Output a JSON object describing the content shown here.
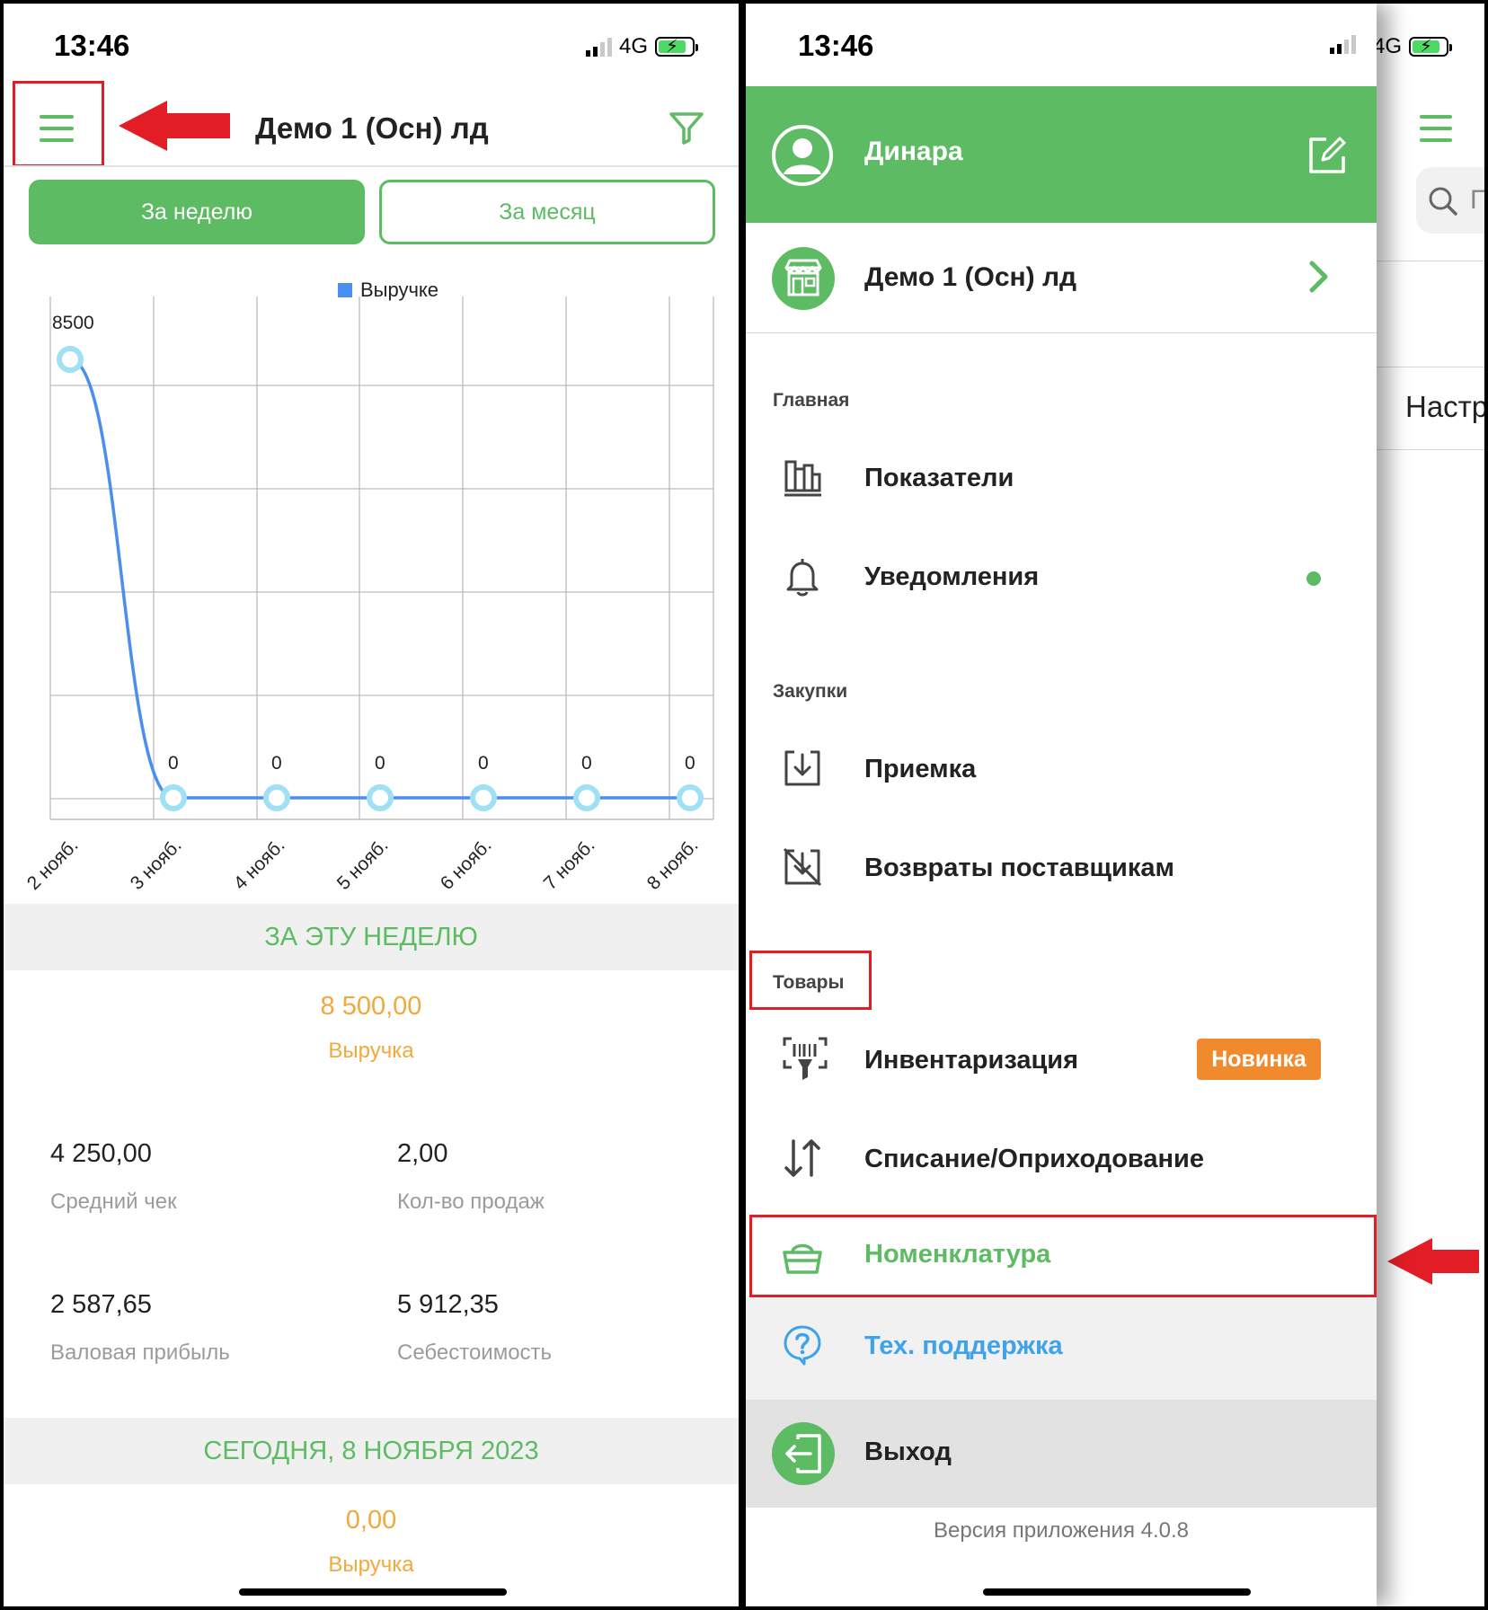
{
  "left": {
    "status": {
      "time": "13:46",
      "network": "4G"
    },
    "header": {
      "title": "Демо 1 (Осн) лд",
      "menu_icon": "hamburger-icon",
      "filter_icon": "funnel-icon"
    },
    "tabs": {
      "week": "За неделю",
      "month": "За месяц"
    },
    "chart_data": {
      "type": "line",
      "legend": "Выручке",
      "categories": [
        "2 нояб.",
        "3 нояб.",
        "4 нояб.",
        "5 нояб.",
        "6 нояб.",
        "7 нояб.",
        "8 нояб."
      ],
      "values": [
        8500,
        0,
        0,
        0,
        0,
        0,
        0
      ],
      "data_labels": [
        "8500",
        "0",
        "0",
        "0",
        "0",
        "0",
        "0"
      ],
      "grid": true,
      "line_color": "#4a8ff0",
      "marker_color": "#9fe0f5"
    },
    "week_summary": {
      "heading": "ЗА ЭТУ НЕДЕЛЮ",
      "revenue_value": "8 500,00",
      "revenue_label": "Выручка",
      "metrics": [
        {
          "value": "4 250,00",
          "label": "Средний чек"
        },
        {
          "value": "2,00",
          "label": "Кол-во продаж"
        },
        {
          "value": "2 587,65",
          "label": "Валовая прибыль"
        },
        {
          "value": "5 912,35",
          "label": "Себестоимость"
        }
      ]
    },
    "today": {
      "heading": "СЕГОДНЯ,  8 НОЯБРЯ 2023",
      "revenue_value": "0,00",
      "revenue_label": "Выручка"
    }
  },
  "right": {
    "status": {
      "time": "13:46",
      "network": "4G"
    },
    "profile": {
      "name": "Динара"
    },
    "store": {
      "name": "Демо 1 (Осн) лд"
    },
    "sections": {
      "main": "Главная",
      "purchases": "Закупки",
      "goods": "Товары"
    },
    "menu": {
      "indicators": "Показатели",
      "notifications": "Уведомления",
      "receiving": "Приемка",
      "returns": "Возвраты поставщикам",
      "inventory": "Инвентаризация",
      "inventory_badge": "Новинка",
      "writeoff": "Списание/Оприходование",
      "nomenclature": "Номенклатура",
      "support": "Тех. поддержка",
      "logout": "Выход"
    },
    "version": "Версия приложения 4.0.8",
    "background_page": {
      "search_fragment": "П",
      "settings_fragment": "Настр"
    },
    "colors": {
      "brand_green": "#5dbb63",
      "support_blue": "#3ea3e8",
      "badge_orange": "#f08a2c",
      "highlight_red": "#e31d25"
    }
  }
}
